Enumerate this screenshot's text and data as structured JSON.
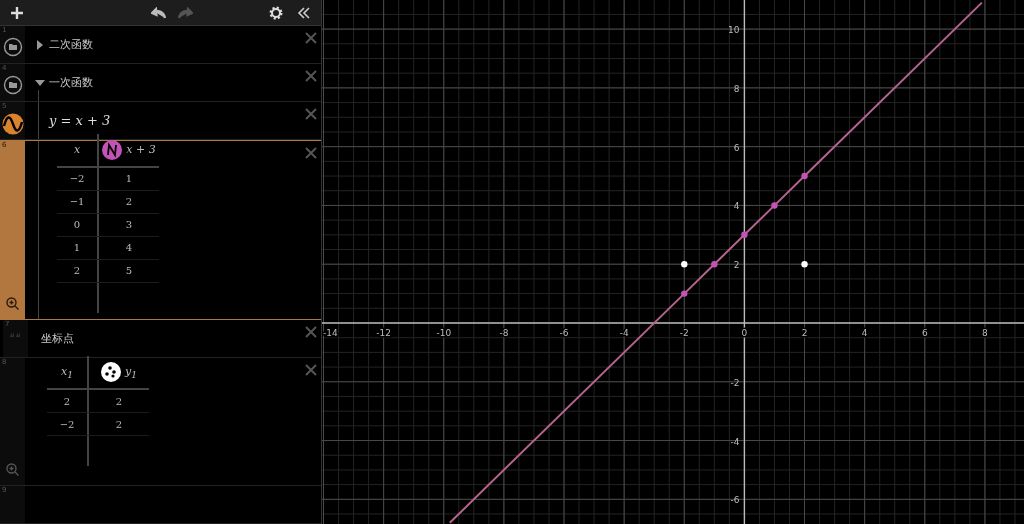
{
  "toolbar": {
    "undo": {
      "disabled": false
    },
    "redo": {
      "disabled": true
    }
  },
  "list": [
    {
      "kind": "folder",
      "index": "1",
      "title": "二次函数",
      "expanded": false
    },
    {
      "kind": "folder",
      "index": "4",
      "title": "一次函数",
      "expanded": true,
      "children": [
        {
          "kind": "expression",
          "index": "5",
          "latex": "y = x + 3",
          "color": "#d9832e"
        },
        {
          "kind": "table",
          "index": "6",
          "selected": true,
          "columns": [
            {
              "label": "x"
            },
            {
              "label": "x + 3",
              "color": "#c453b8",
              "kind": "line"
            }
          ],
          "rows": [
            [
              "−2",
              "1"
            ],
            [
              "−1",
              "2"
            ],
            [
              "0",
              "3"
            ],
            [
              "1",
              "4"
            ],
            [
              "2",
              "5"
            ]
          ]
        }
      ]
    },
    {
      "kind": "note",
      "index": "7",
      "text": "坐标点"
    },
    {
      "kind": "table",
      "index": "8",
      "selected": false,
      "columns": [
        {
          "label": "x$_{1}$"
        },
        {
          "label": "y$_{1}$",
          "color": "#ffffff",
          "kind": "points"
        }
      ],
      "rows": [
        [
          "2",
          "2"
        ],
        [
          "−2",
          "2"
        ]
      ]
    },
    {
      "kind": "empty",
      "index": "9"
    }
  ],
  "graph": {
    "chart_data": {
      "type": "line",
      "x": [
        -9.8,
        -2,
        -1,
        0,
        1,
        2,
        7.9
      ],
      "series": [
        {
          "color": "#b5638f",
          "values": [
            -6.8,
            1,
            2,
            3,
            4,
            5,
            10.9
          ]
        },
        {
          "type": "scatter",
          "color": "#c453b8",
          "values": [
            null,
            1,
            2,
            3,
            4,
            5,
            null
          ]
        },
        {
          "type": "scatter",
          "color": "#ffffff",
          "values": [
            null,
            2,
            null,
            null,
            null,
            2,
            null
          ]
        }
      ],
      "grid": true,
      "xlim": [
        -14.05,
        9.3
      ],
      "ylim": [
        -6.84,
        10.99
      ],
      "xticks": [
        -14,
        -12,
        -10,
        -8,
        -6,
        -4,
        -2,
        0,
        2,
        4,
        6,
        8
      ],
      "yticks": [
        -6,
        -4,
        -2,
        2,
        4,
        6,
        8,
        10
      ]
    }
  }
}
